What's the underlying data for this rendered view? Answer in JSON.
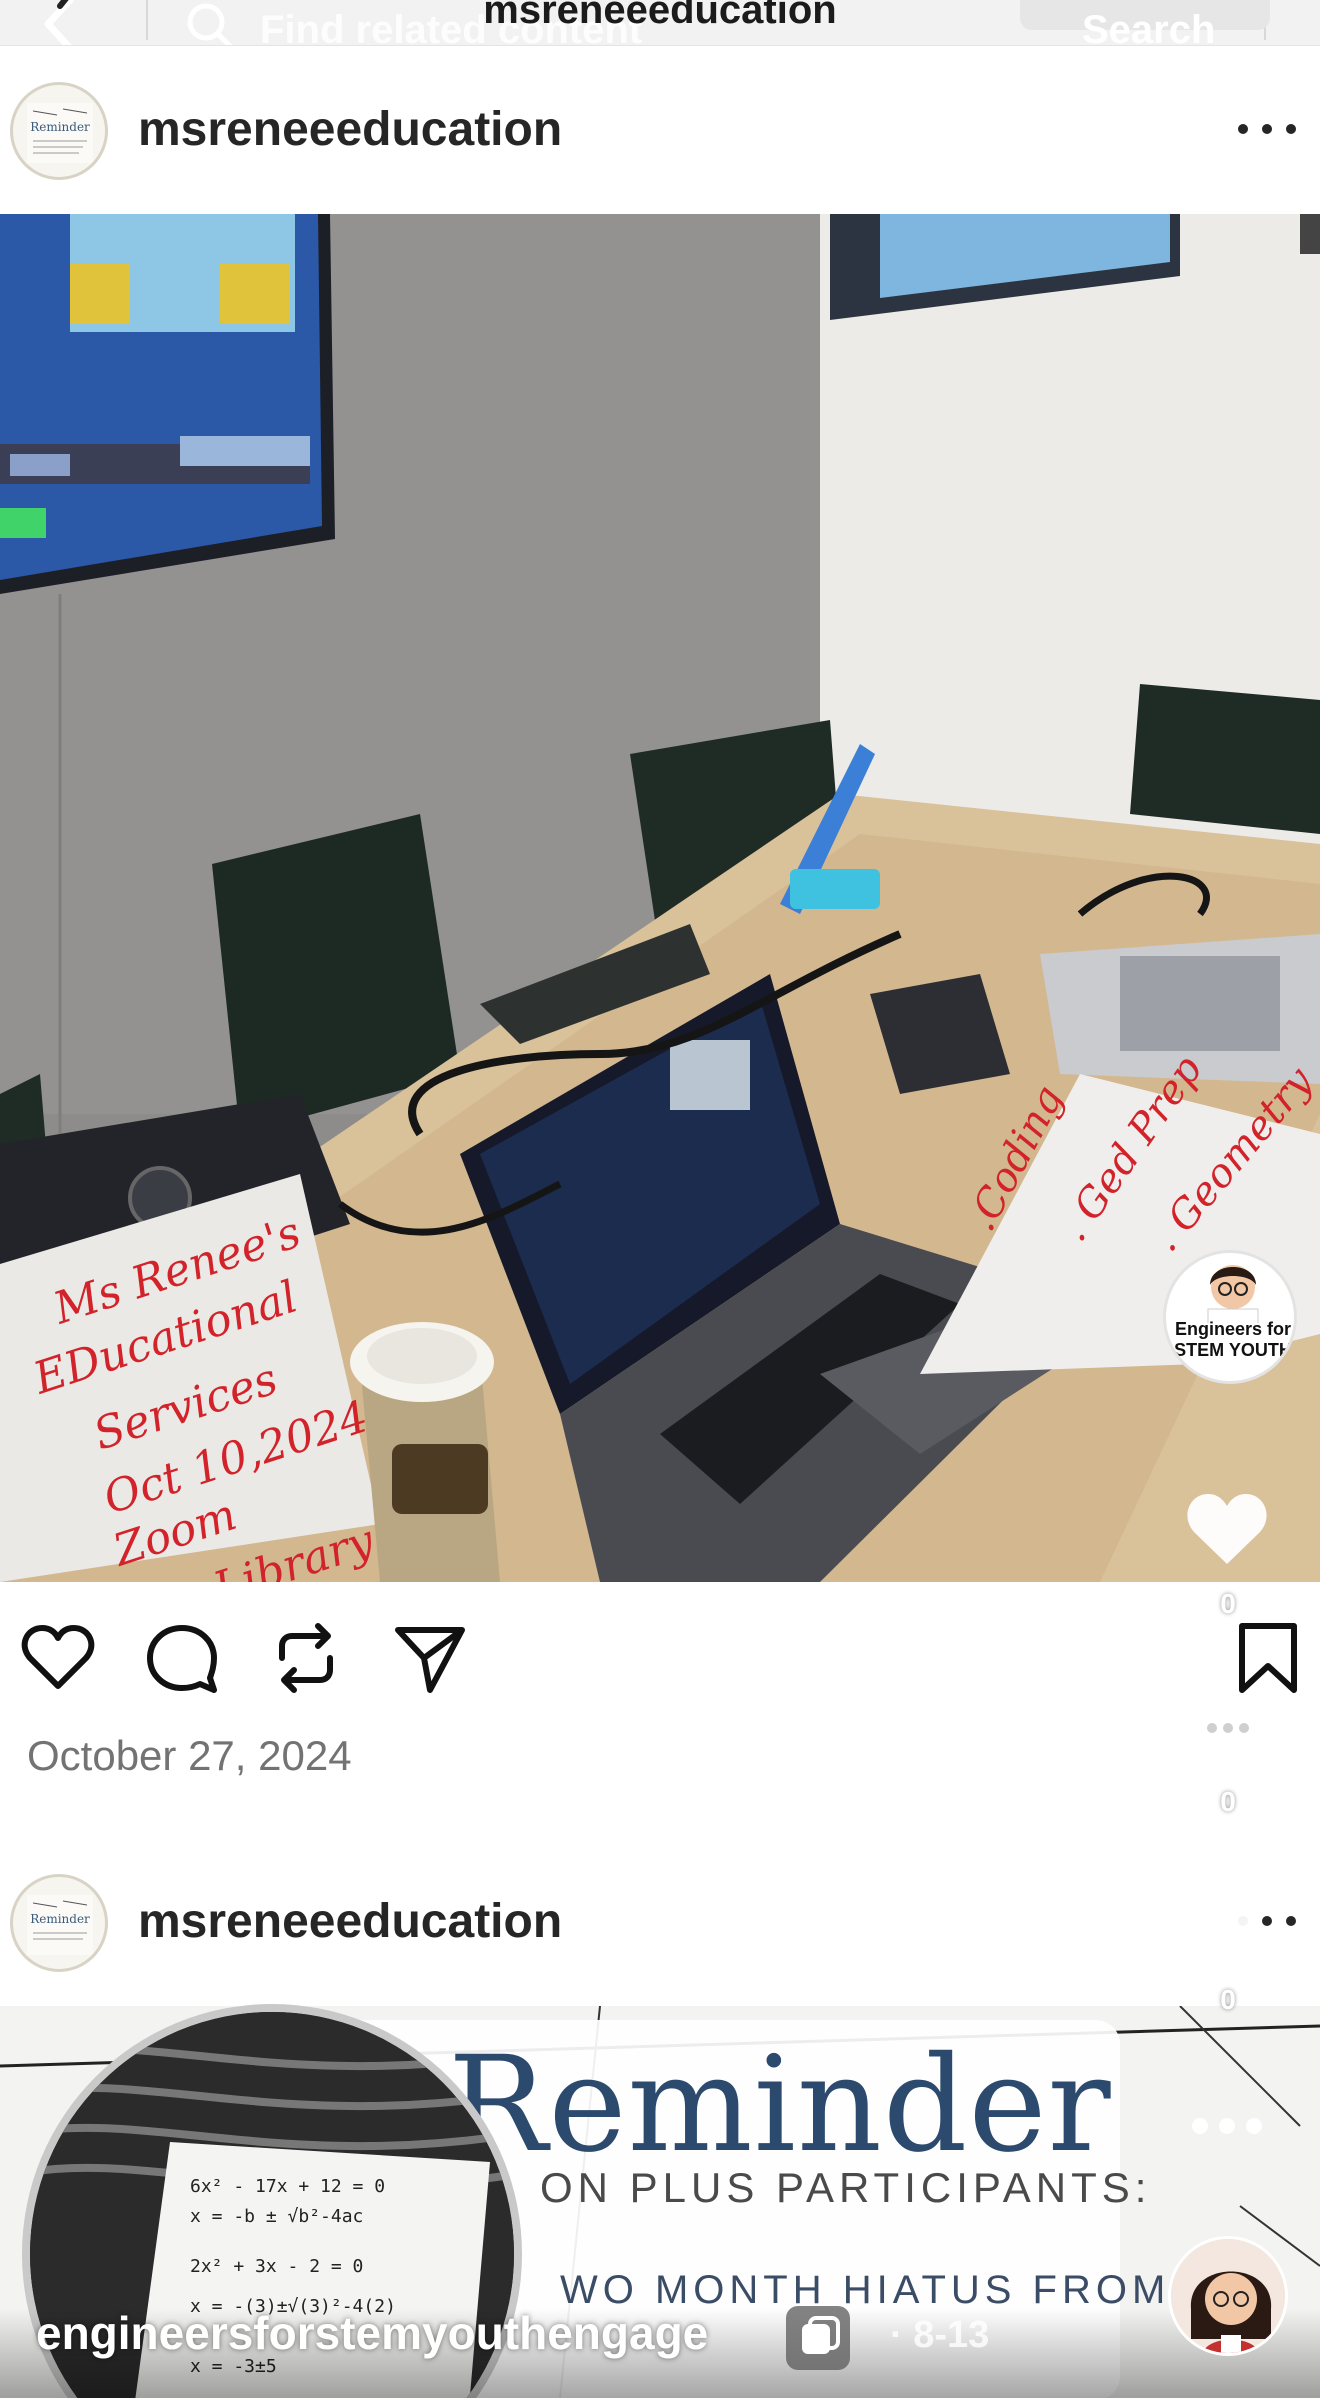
{
  "topbar": {
    "title": "msreneeeducation",
    "search_placeholder": "Find related content",
    "search_label": "Search"
  },
  "post1": {
    "username": "msreneeeducation",
    "date": "October 27, 2024",
    "whiteboard_left": [
      "Ms Renee's",
      "EDucational",
      "Services",
      "Oct 10,2024",
      "Zoom",
      "Library"
    ],
    "whiteboard_right": [
      ".Coding",
      ". Ged Prep",
      ". Geometry"
    ]
  },
  "post2": {
    "username": "msreneeeducation",
    "reminder_title": "Reminder",
    "reminder_line1": "ON PLUS PARTICIPANTS:",
    "reminder_line2": "WO MONTH HIATUS FROM"
  },
  "overlay": {
    "promo_label": "Engineers for STEM YOUTH",
    "like_count": "0",
    "comment_count": "0",
    "save_count": "0",
    "account_handle": "engineersforstemyouthengage",
    "date_fragment": "· 8-13"
  },
  "colors": {
    "text_primary": "#262626",
    "text_secondary": "#737373",
    "reminder_blue": "#2c4a6e",
    "marker_red": "#d2232a"
  },
  "icons": {
    "back": "chevron-left-icon",
    "search": "search-icon",
    "more": "more-horizontal-icon",
    "like": "heart-icon",
    "comment": "comment-icon",
    "repost": "repost-icon",
    "share": "send-icon",
    "save": "bookmark-icon",
    "carousel": "copy-icon"
  }
}
